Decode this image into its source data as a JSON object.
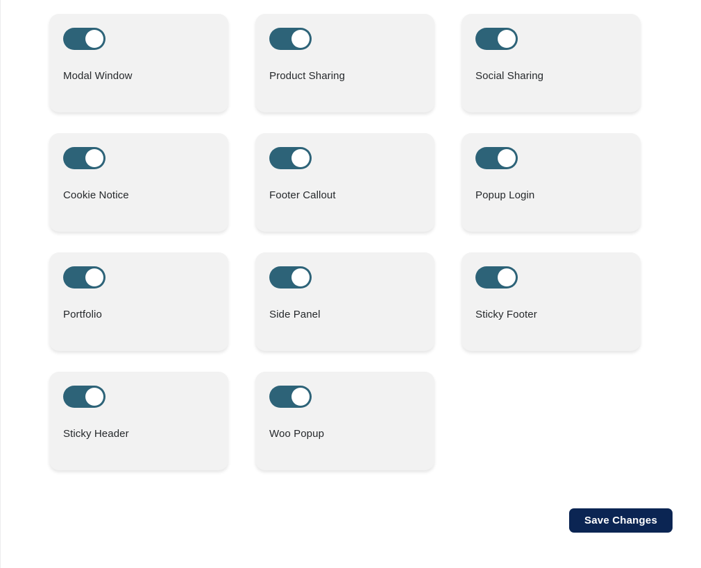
{
  "page": {
    "background_color": "#ffffff",
    "card_background_color": "#f2f2f2",
    "toggle_on_color": "#2d6378",
    "toggle_knob_color": "#ffffff",
    "label_text_color": "#25282b",
    "button_color": "#0b2553"
  },
  "toggles": [
    {
      "id": "modal-window",
      "label": "Modal Window",
      "state": "on",
      "state_label": "On"
    },
    {
      "id": "product-sharing",
      "label": "Product Sharing",
      "state": "on",
      "state_label": "On"
    },
    {
      "id": "social-sharing",
      "label": "Social Sharing",
      "state": "on",
      "state_label": "On"
    },
    {
      "id": "cookie-notice",
      "label": "Cookie Notice",
      "state": "on",
      "state_label": "On"
    },
    {
      "id": "footer-callout",
      "label": "Footer Callout",
      "state": "on",
      "state_label": "On"
    },
    {
      "id": "popup-login",
      "label": "Popup Login",
      "state": "on",
      "state_label": "On"
    },
    {
      "id": "portfolio",
      "label": "Portfolio",
      "state": "on",
      "state_label": "On"
    },
    {
      "id": "side-panel",
      "label": "Side Panel",
      "state": "on",
      "state_label": "On"
    },
    {
      "id": "sticky-footer",
      "label": "Sticky Footer",
      "state": "on",
      "state_label": "On"
    },
    {
      "id": "sticky-header",
      "label": "Sticky Header",
      "state": "on",
      "state_label": "On"
    },
    {
      "id": "woo-popup",
      "label": "Woo Popup",
      "state": "on",
      "state_label": "On"
    }
  ],
  "footer": {
    "save_label": "Save Changes"
  }
}
